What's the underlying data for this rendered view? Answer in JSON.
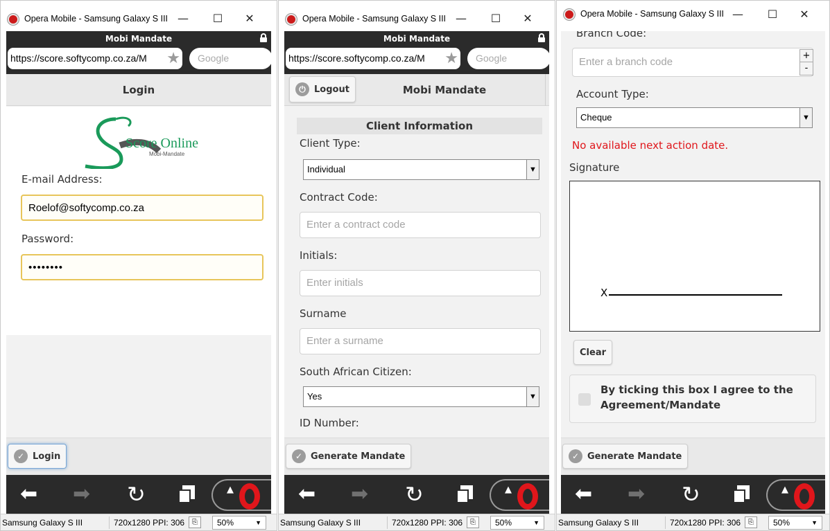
{
  "window_title": "Opera Mobile - Samsung Galaxy S III",
  "window_controls": {
    "minimize": "—",
    "maximize": "☐",
    "close": "✕"
  },
  "browser": {
    "page_title": "Mobi Mandate",
    "url": "https://score.softycomp.co.za/M",
    "search_placeholder": "Google"
  },
  "statusbar": {
    "device": "Samsung Galaxy S III",
    "resolution": "720x1280",
    "ppi": "PPI: 306",
    "zoom": "50%"
  },
  "login_screen": {
    "header": "Login",
    "logo_text": "Score Online",
    "logo_subtext": "Mobi-Mandate",
    "email_label": "E-mail Address:",
    "email_value": "Roelof@softycomp.co.za",
    "password_label": "Password:",
    "password_value": "••••••••",
    "login_button": "Login"
  },
  "client_screen": {
    "logout_button": "Logout",
    "header": "Mobi Mandate",
    "section_title": "Client Information",
    "client_type_label": "Client Type:",
    "client_type_value": "Individual",
    "contract_code_label": "Contract Code:",
    "contract_code_placeholder": "Enter a contract code",
    "initials_label": "Initials:",
    "initials_placeholder": "Enter initials",
    "surname_label": "Surname",
    "surname_placeholder": "Enter a surname",
    "citizen_label": "South African Citizen:",
    "citizen_value": "Yes",
    "id_label": "ID Number:",
    "generate_button": "Generate Mandate"
  },
  "signature_screen": {
    "branch_code_label": "Branch Code:",
    "branch_code_placeholder": "Enter a branch code",
    "stepper_plus": "+",
    "stepper_minus": "-",
    "account_type_label": "Account Type:",
    "account_type_value": "Cheque",
    "error_text": "No available next action date.",
    "error_color": "#e0161b",
    "signature_label": "Signature",
    "signature_x": "X",
    "clear_button": "Clear",
    "agree_text": "By ticking this box I agree to the Agreement/Mandate",
    "generate_button": "Generate Mandate"
  },
  "colors": {
    "browser_bar": "#2b2b2b",
    "focus_border": "#e7c55a",
    "opera_red": "#e0161b",
    "logo_green": "#1a9a5a",
    "logo_gray": "#555555"
  }
}
